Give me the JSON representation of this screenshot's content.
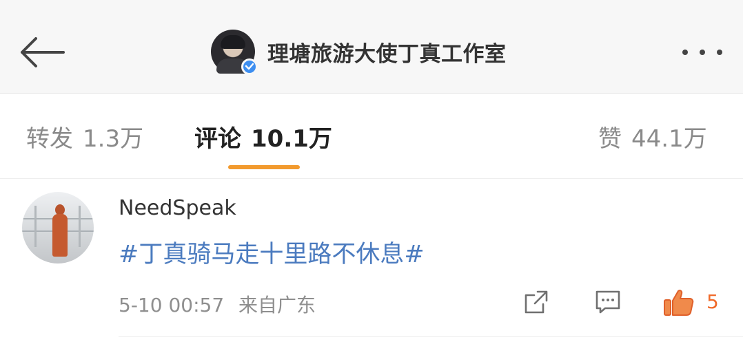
{
  "header": {
    "title": "理塘旅游大使丁真工作室",
    "back_icon": "arrow-left-icon",
    "more_icon": "more-dots-icon",
    "verified_badge_color": "#3d8ef0"
  },
  "tabs": [
    {
      "label": "转发",
      "count": "1.3万",
      "active": false
    },
    {
      "label": "评论",
      "count": "10.1万",
      "active": true
    },
    {
      "label": "赞",
      "count": "44.1万",
      "active": false
    }
  ],
  "accent_color": "#f29a2e",
  "comment": {
    "username": "NeedSpeak",
    "text": "#丁真骑马走十里路不休息#",
    "date": "5-10 00:57",
    "location": "来自广东",
    "like_count": "5",
    "link_color": "#4b7bbf",
    "like_color": "#f06a2a",
    "icons": [
      "share-icon",
      "reply-icon",
      "like-icon"
    ]
  }
}
